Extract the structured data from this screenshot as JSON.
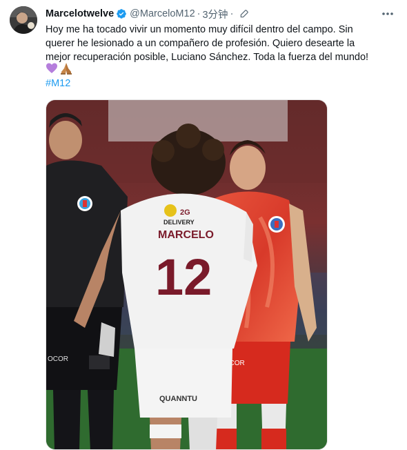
{
  "tweet": {
    "display_name": "Marcelotwelve",
    "handle": "@MarceloM12",
    "separator": "·",
    "time": "3分钟",
    "separator2": "·",
    "text_lines": [
      "Hoy me ha tocado vivir un momento muy difícil dentro del campo. Sin",
      "querer he lesionado a un compañero de profesión. Quiero desearte la",
      "mejor recuperación posible, Luciano Sánchez. Toda la fuerza del mundo!"
    ],
    "emojis": [
      "purple-heart",
      "folded-hands"
    ],
    "hashtag": "#M12",
    "photo": {
      "jersey_back": {
        "sponsor": "DELIVERY",
        "name": "MARCELO",
        "number": "12",
        "short_sponsor": "QUANNTU"
      },
      "dark_shorts_text": "OCOR",
      "red_shorts_text": "NGIOCOR"
    }
  },
  "colors": {
    "text": "#0f1419",
    "secondary": "#536471",
    "link": "#1d9bf0",
    "verified": "#1d9bf0"
  }
}
